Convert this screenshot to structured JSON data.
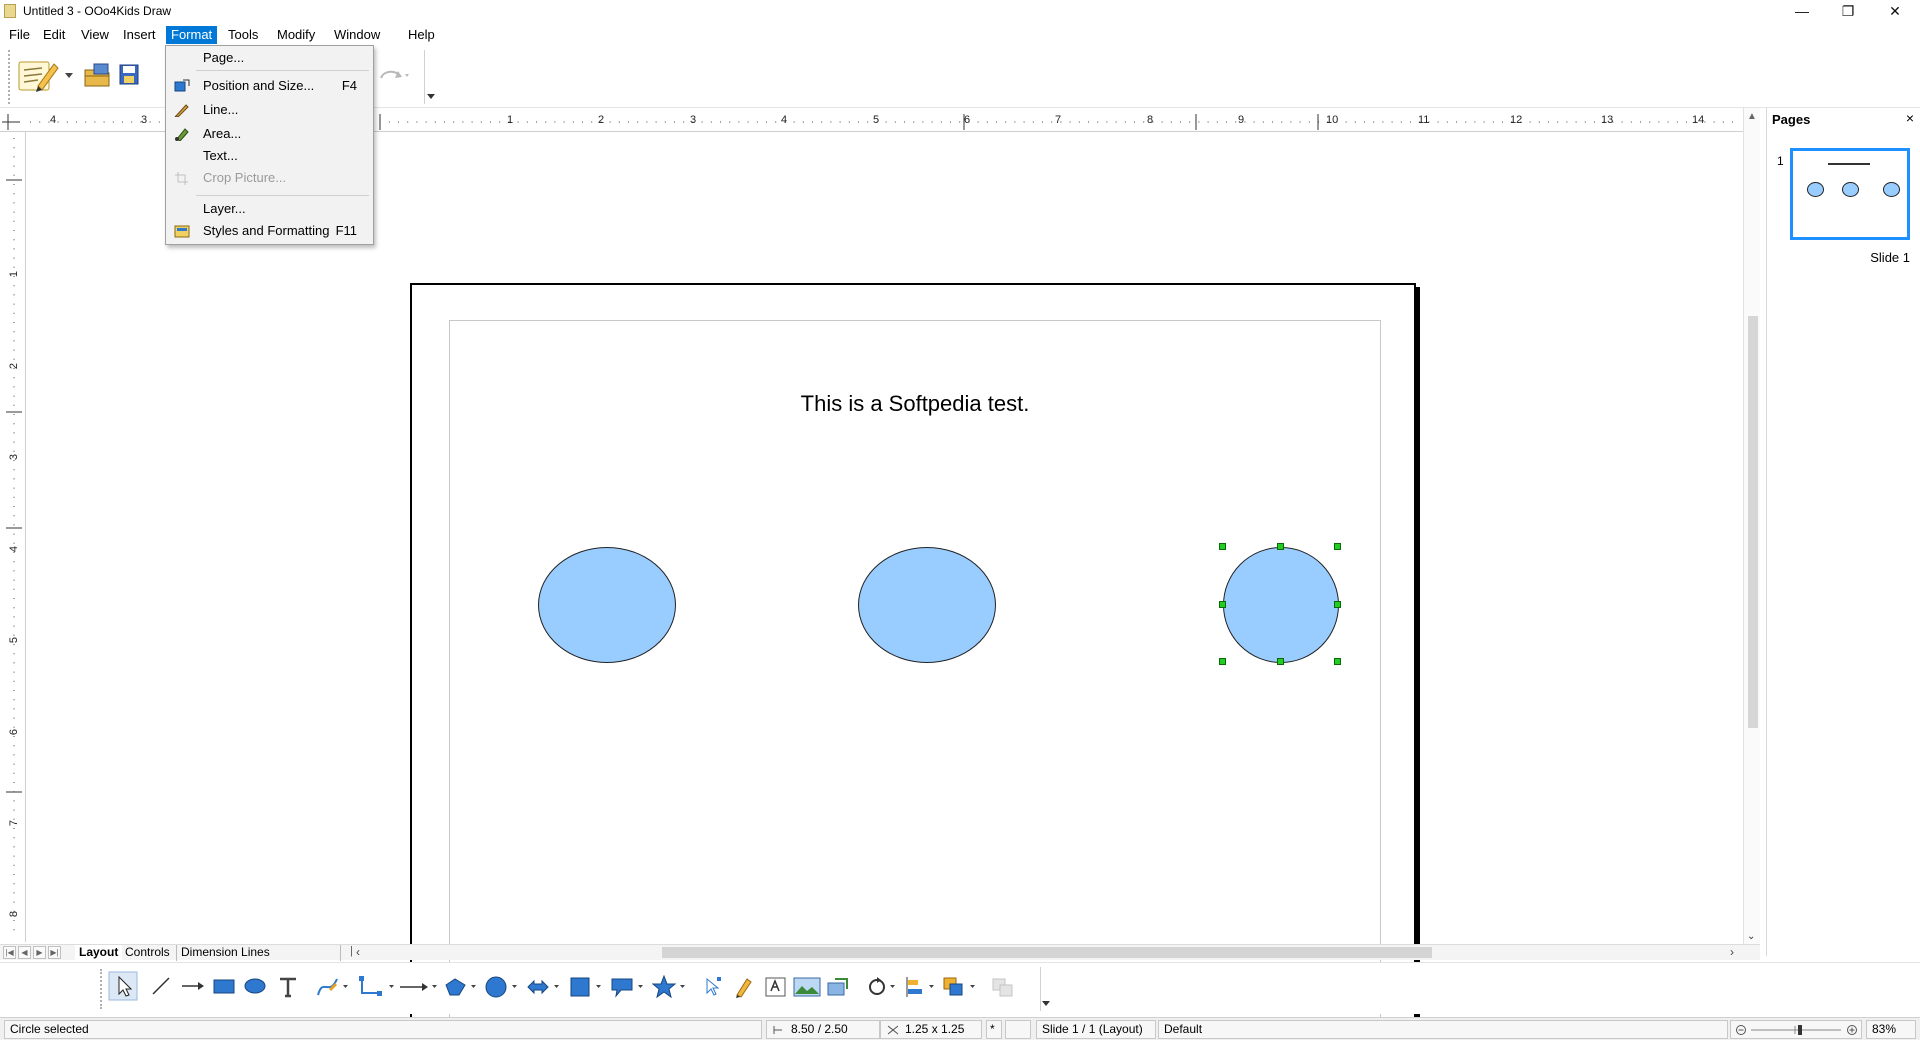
{
  "window": {
    "title": "Untitled 3 - OOo4Kids Draw",
    "controls": [
      "minimize",
      "restore",
      "close"
    ]
  },
  "menubar": {
    "items": [
      {
        "label": "File",
        "active": false
      },
      {
        "label": "Edit",
        "active": false
      },
      {
        "label": "View",
        "active": false
      },
      {
        "label": "Insert",
        "active": false
      },
      {
        "label": "Format",
        "active": true
      },
      {
        "label": "Tools",
        "active": false
      },
      {
        "label": "Modify",
        "active": false
      },
      {
        "label": "Window",
        "active": false
      },
      {
        "label": "Help",
        "active": false
      }
    ]
  },
  "format_menu": {
    "items": [
      {
        "label": "Page...",
        "shortcut": "",
        "enabled": true,
        "icon": ""
      },
      {
        "label": "Position and Size...",
        "shortcut": "F4",
        "enabled": true,
        "icon": "position-size-icon"
      },
      {
        "label": "Line...",
        "shortcut": "",
        "enabled": true,
        "icon": "line-pen-icon"
      },
      {
        "label": "Area...",
        "shortcut": "",
        "enabled": true,
        "icon": "area-brush-icon"
      },
      {
        "label": "Text...",
        "shortcut": "",
        "enabled": true,
        "icon": ""
      },
      {
        "label": "Crop Picture...",
        "shortcut": "",
        "enabled": false,
        "icon": "crop-icon"
      },
      {
        "label": "Layer...",
        "shortcut": "",
        "enabled": true,
        "icon": ""
      },
      {
        "label": "Styles and Formatting",
        "shortcut": "F11",
        "enabled": true,
        "icon": "styles-icon"
      }
    ]
  },
  "rulers": {
    "horizontal": [
      "4",
      "3",
      "1",
      "2",
      "3",
      "4",
      "5",
      "6",
      "7",
      "8",
      "9",
      "10",
      "11",
      "12",
      "13",
      "14"
    ],
    "vertical": [
      "1",
      "2",
      "3",
      "4",
      "5",
      "6",
      "7",
      "8"
    ]
  },
  "document": {
    "text": "This is a Softpedia test.",
    "shapes": [
      {
        "type": "ellipse",
        "fill": "#99ccff",
        "selected": false
      },
      {
        "type": "ellipse",
        "fill": "#99ccff",
        "selected": false
      },
      {
        "type": "circle",
        "fill": "#99ccff",
        "selected": true
      }
    ],
    "selection_handle_color": "#22cc22"
  },
  "pages_panel": {
    "title": "Pages",
    "close_label": "×",
    "pages": [
      {
        "number": "1",
        "label": "Slide 1",
        "selected": true
      }
    ]
  },
  "layer_tabs": {
    "tabs": [
      "Layout",
      "Controls",
      "Dimension Lines"
    ],
    "active": "Layout"
  },
  "statusbar": {
    "message": "Circle selected",
    "position": "8.50 / 2.50",
    "size": "1.25 x 1.25",
    "modified": "*",
    "slide": "Slide 1 / 1 (Layout)",
    "style": "Default",
    "zoom": "83%"
  },
  "colors": {
    "accent": "#0078d7",
    "shape_fill": "#99ccff",
    "thumb_border": "#1e90ff"
  }
}
